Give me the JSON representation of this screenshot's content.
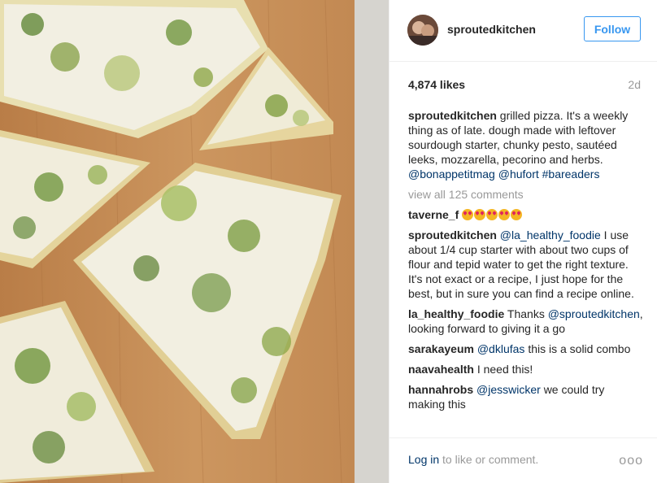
{
  "post": {
    "username": "sproutedkitchen",
    "follow_label": "Follow",
    "likes": "4,874 likes",
    "time_ago": "2d",
    "caption": {
      "user": "sproutedkitchen",
      "text": "grilled pizza. It's a weekly thing as of late. dough made with leftover sourdough starter, chunky pesto, sautéed leeks, mozzarella, pecorino and herbs.",
      "tags": "@bonappetitmag @hufort #bareaders"
    },
    "view_all": "view all 125 comments"
  },
  "comments": [
    {
      "user": "taverne_f",
      "emoji": "heart-eyes-emoji x5"
    },
    {
      "user": "sproutedkitchen",
      "mention": "@la_healthy_foodie",
      "text": "I use about 1/4 cup starter with about two cups of flour and tepid water to get the right texture. It's not exact or a recipe, I just hope for the best, but in sure you can find a recipe online."
    },
    {
      "user": "la_healthy_foodie",
      "text_before": "Thanks",
      "mention": "@sproutedkitchen",
      "text": ", looking forward to giving it a go"
    },
    {
      "user": "sarakayeum",
      "mention": "@dklufas",
      "text": "this is a solid combo"
    },
    {
      "user": "naavahealth",
      "text": "I need this!"
    },
    {
      "user": "hannahrobs",
      "mention": "@jesswicker",
      "text": "we could try making this"
    }
  ],
  "footer": {
    "login_link": "Log in",
    "login_rest": "to like or comment.",
    "more": "ooo"
  },
  "colors": {
    "accent": "#3897f0",
    "link": "#003569",
    "muted": "#999999",
    "text": "#262626"
  },
  "icons": {
    "more": "more-options-icon",
    "emoji": "heart-eyes-emoji"
  }
}
